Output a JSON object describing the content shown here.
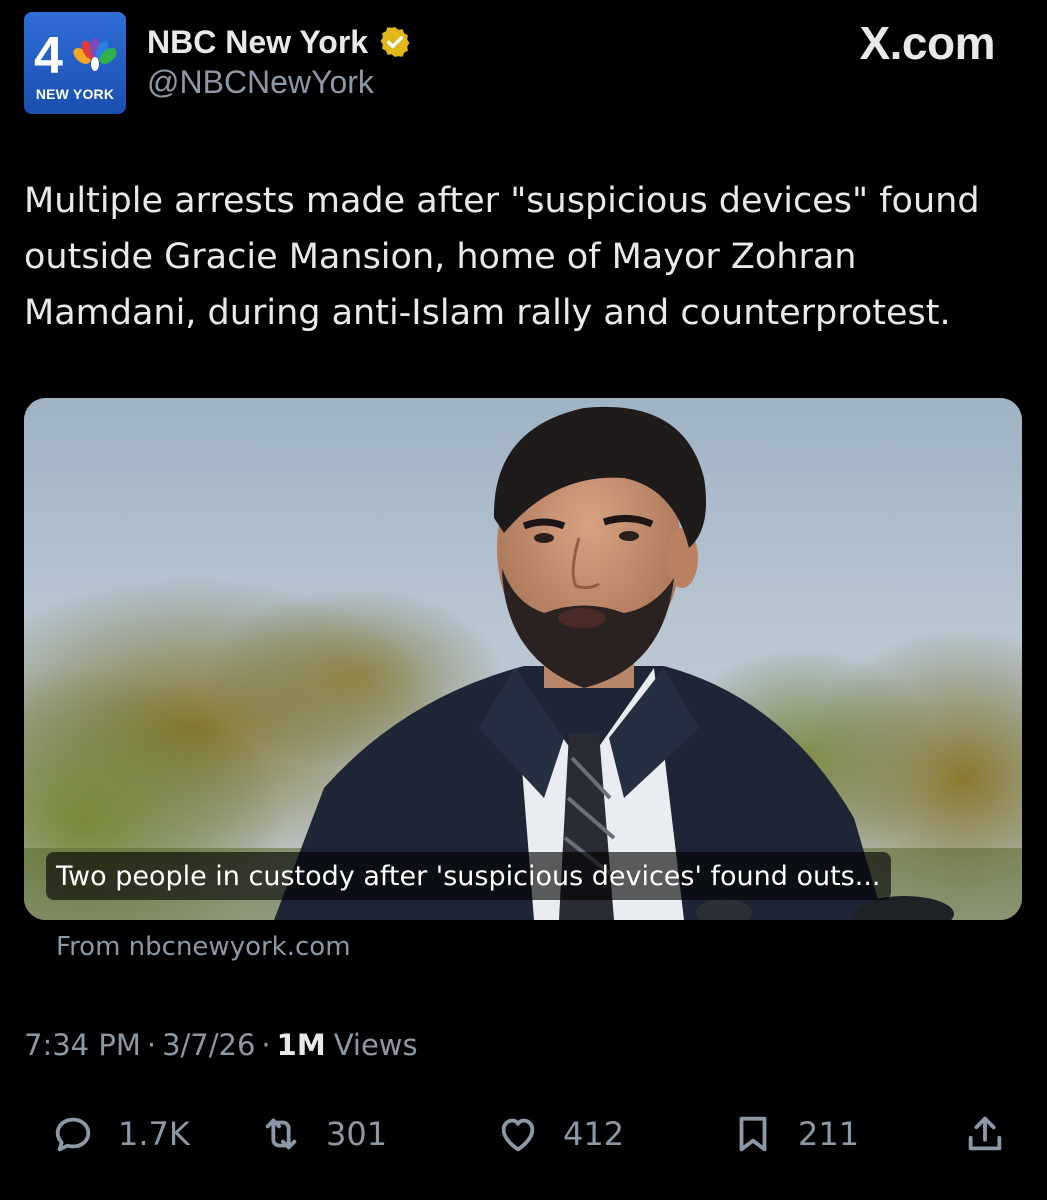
{
  "profile": {
    "avatar_number": "4",
    "avatar_city": "NEW YORK",
    "display_name": "NBC New York",
    "handle": "@NBCNewYork",
    "verified_color": "#e2b719"
  },
  "watermark": "X.com",
  "tweet": {
    "text": "Multiple arrests made after \"suspicious devices\" found outside Gracie Mansion, home of Mayor Zohran Mamdani, during anti-Islam rally and counterprotest."
  },
  "link_card": {
    "caption": "Two people in custody after 'suspicious devices' found outs...",
    "source": "From nbcnewyork.com"
  },
  "meta": {
    "time": "7:34 PM",
    "separator": "·",
    "date": "3/7/26",
    "views_count": "1M",
    "views_label": "Views"
  },
  "actions": {
    "reply_icon": "reply-icon",
    "reply_count": "1.7K",
    "repost_icon": "repost-icon",
    "repost_count": "301",
    "like_icon": "heart-icon",
    "like_count": "412",
    "bookmark_icon": "bookmark-icon",
    "bookmark_count": "211",
    "share_icon": "share-icon"
  },
  "colors": {
    "background": "#000000",
    "text": "#e7e9ea",
    "secondary_text": "#8b98a5",
    "avatar_blue": "#2563c9"
  }
}
